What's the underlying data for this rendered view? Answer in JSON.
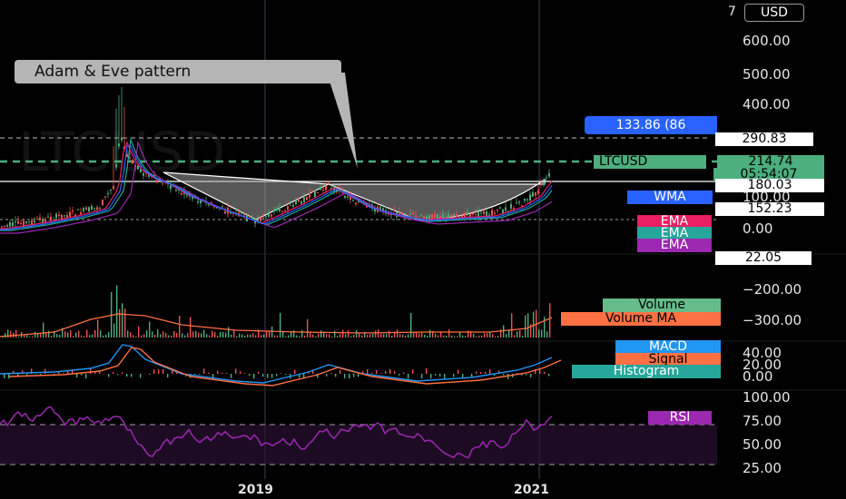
{
  "currency_selector": "USD",
  "axis_top_label": "7",
  "annotation": "Adam & Eve pattern",
  "price_axis": {
    "ticks": [
      "600.00",
      "500.00",
      "400.00",
      "100.00",
      "0.00"
    ],
    "symbol_label": "LTCUSD",
    "last_price": "214.74",
    "countdown": "05:54:07",
    "level_290": "290.83",
    "level_180": "180.03",
    "level_152": "152.23",
    "level_22": "22.05",
    "measure_tag": "133.86 (86"
  },
  "indicator_tags": {
    "wma": "WMA",
    "ema1": "EMA",
    "ema2": "EMA",
    "ema3": "EMA",
    "volume": "Volume",
    "volume_ma": "Volume MA",
    "macd": "MACD",
    "signal": "Signal",
    "histogram": "Histogram",
    "rsi": "RSI"
  },
  "volume_axis": [
    "−200.00",
    "−300.00"
  ],
  "macd_axis": [
    "40.00",
    "20.00",
    "0.00"
  ],
  "rsi_axis": [
    "100.00",
    "75.00",
    "50.00",
    "25.00"
  ],
  "time_axis": [
    "2019",
    "2021"
  ],
  "colors": {
    "green": "#4caf7d",
    "red": "#ef5350",
    "blue_tag": "#2962ff",
    "ema_pink": "#e91e63",
    "ema_teal": "#26a69a",
    "ema_purple": "#9c27b0",
    "volume_green": "#66bb8a",
    "orange": "#ff7043",
    "rsi": "#9c27b0"
  }
}
